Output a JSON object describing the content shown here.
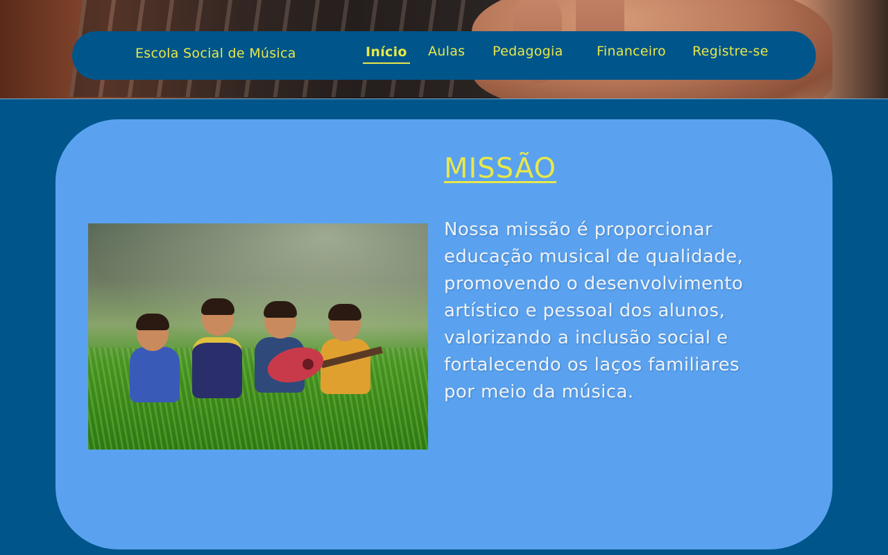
{
  "header": {
    "brand": "Escola Social de Música",
    "nav": [
      {
        "label": "Início",
        "active": true
      },
      {
        "label": "Aulas",
        "active": false
      },
      {
        "label": "Pedagogia",
        "active": false
      },
      {
        "label": "Financeiro",
        "active": false
      },
      {
        "label": "Registre-se",
        "active": false
      }
    ]
  },
  "mission": {
    "title": "MISSÃO",
    "text": "Nossa missão é proporcionar educação musical de qualidade, promovendo o desenvolvimento artístico e pessoal dos alunos, valorizando a inclusão social e fortalecendo os laços familiares por meio da música."
  },
  "colors": {
    "page_background": "#00558a",
    "navbar_background": "#00558a",
    "accent_yellow": "#e9e84a",
    "card_background": "#5aa2ef",
    "body_text": "#eef3f9"
  },
  "images": {
    "hero": "guitar-playing-hand-photo",
    "mission_photo": "children-with-ukulele-in-grass-photo"
  }
}
